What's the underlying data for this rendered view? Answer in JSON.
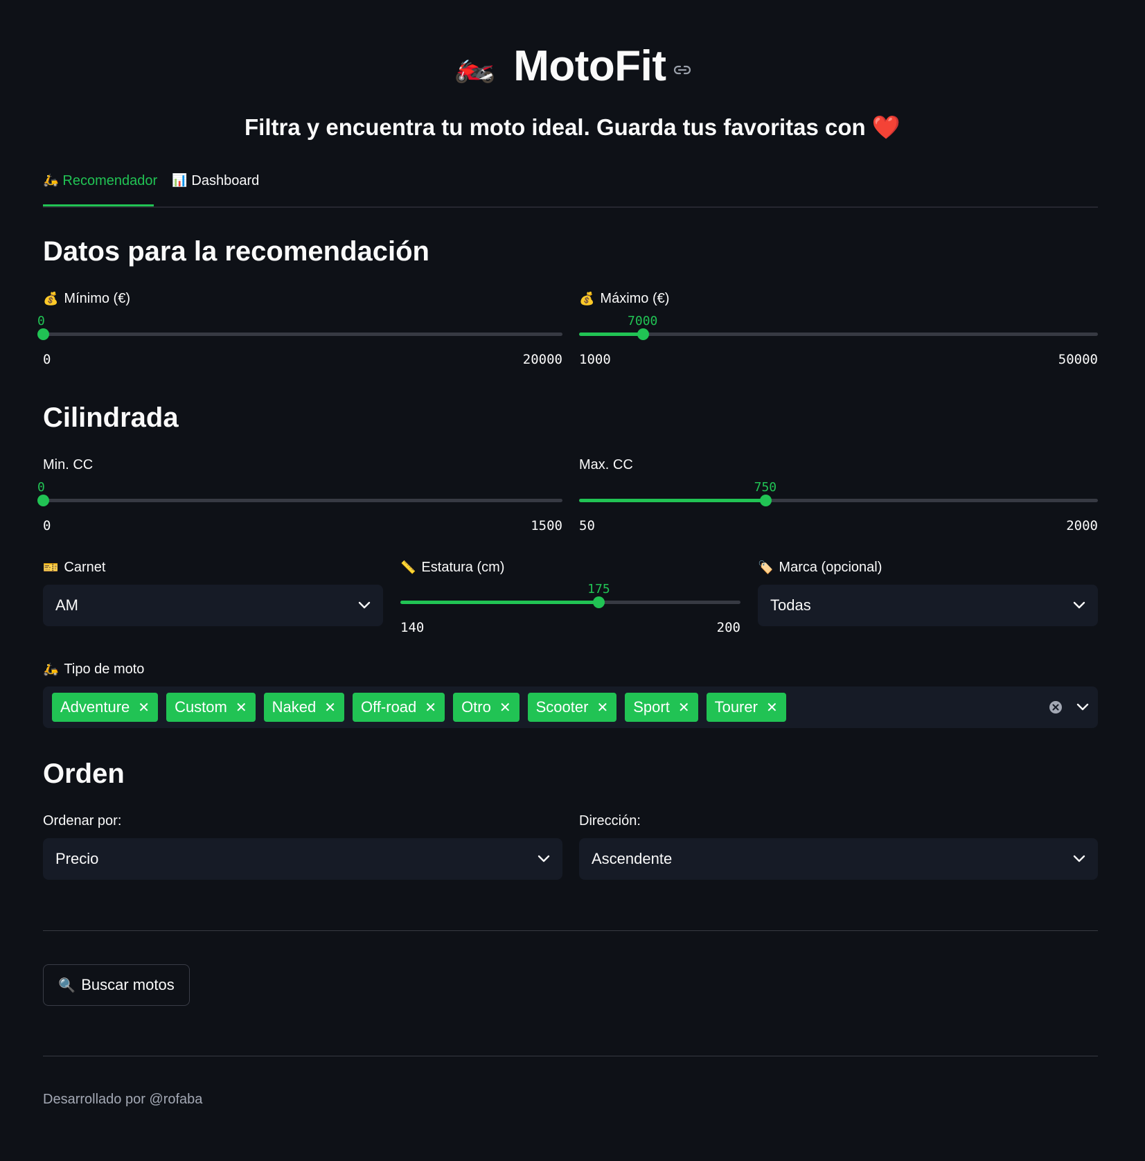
{
  "app": {
    "title": "MotoFit",
    "title_emoji": "🏍️",
    "subtitle": "Filtra y encuentra tu moto ideal. Guarda tus favoritas con ❤️"
  },
  "tabs": [
    {
      "icon": "🛵",
      "label": "Recomendador",
      "active": true
    },
    {
      "icon": "📊",
      "label": "Dashboard",
      "active": false
    }
  ],
  "sections": {
    "recommendation": "Datos para la recomendación",
    "cilindrada": "Cilindrada",
    "orden": "Orden"
  },
  "price": {
    "min": {
      "icon": "💰",
      "label": "Mínimo (€)",
      "value": 0,
      "min": 0,
      "max": 20000,
      "value_text": "0",
      "min_text": "0",
      "max_text": "20000"
    },
    "max": {
      "icon": "💰",
      "label": "Máximo (€)",
      "value": 7000,
      "min": 1000,
      "max": 50000,
      "value_text": "7000",
      "min_text": "1000",
      "max_text": "50000"
    }
  },
  "cc": {
    "min": {
      "label": "Min. CC",
      "value": 0,
      "min": 0,
      "max": 1500,
      "value_text": "0",
      "min_text": "0",
      "max_text": "1500"
    },
    "max": {
      "label": "Max. CC",
      "value": 750,
      "min": 50,
      "max": 2000,
      "value_text": "750",
      "min_text": "50",
      "max_text": "2000"
    }
  },
  "carnet": {
    "icon": "🎫",
    "label": "Carnet",
    "value": "AM"
  },
  "estatura": {
    "icon": "📏",
    "label": "Estatura (cm)",
    "value": 175,
    "min": 140,
    "max": 200,
    "value_text": "175",
    "min_text": "140",
    "max_text": "200"
  },
  "marca": {
    "icon": "🏷️",
    "label": "Marca (opcional)",
    "value": "Todas"
  },
  "tipo": {
    "icon": "🛵",
    "label": "Tipo de moto",
    "selected": [
      "Adventure",
      "Custom",
      "Naked",
      "Off-road",
      "Otro",
      "Scooter",
      "Sport",
      "Tourer"
    ]
  },
  "orden": {
    "sort_label": "Ordenar por:",
    "sort_value": "Precio",
    "dir_label": "Dirección:",
    "dir_value": "Ascendente"
  },
  "search_button": {
    "icon": "🔍",
    "label": "Buscar motos"
  },
  "footer": "Desarrollado por @rofaba",
  "colors": {
    "accent": "#21c354",
    "background": "#0e1117",
    "input_bg": "#161b26"
  }
}
